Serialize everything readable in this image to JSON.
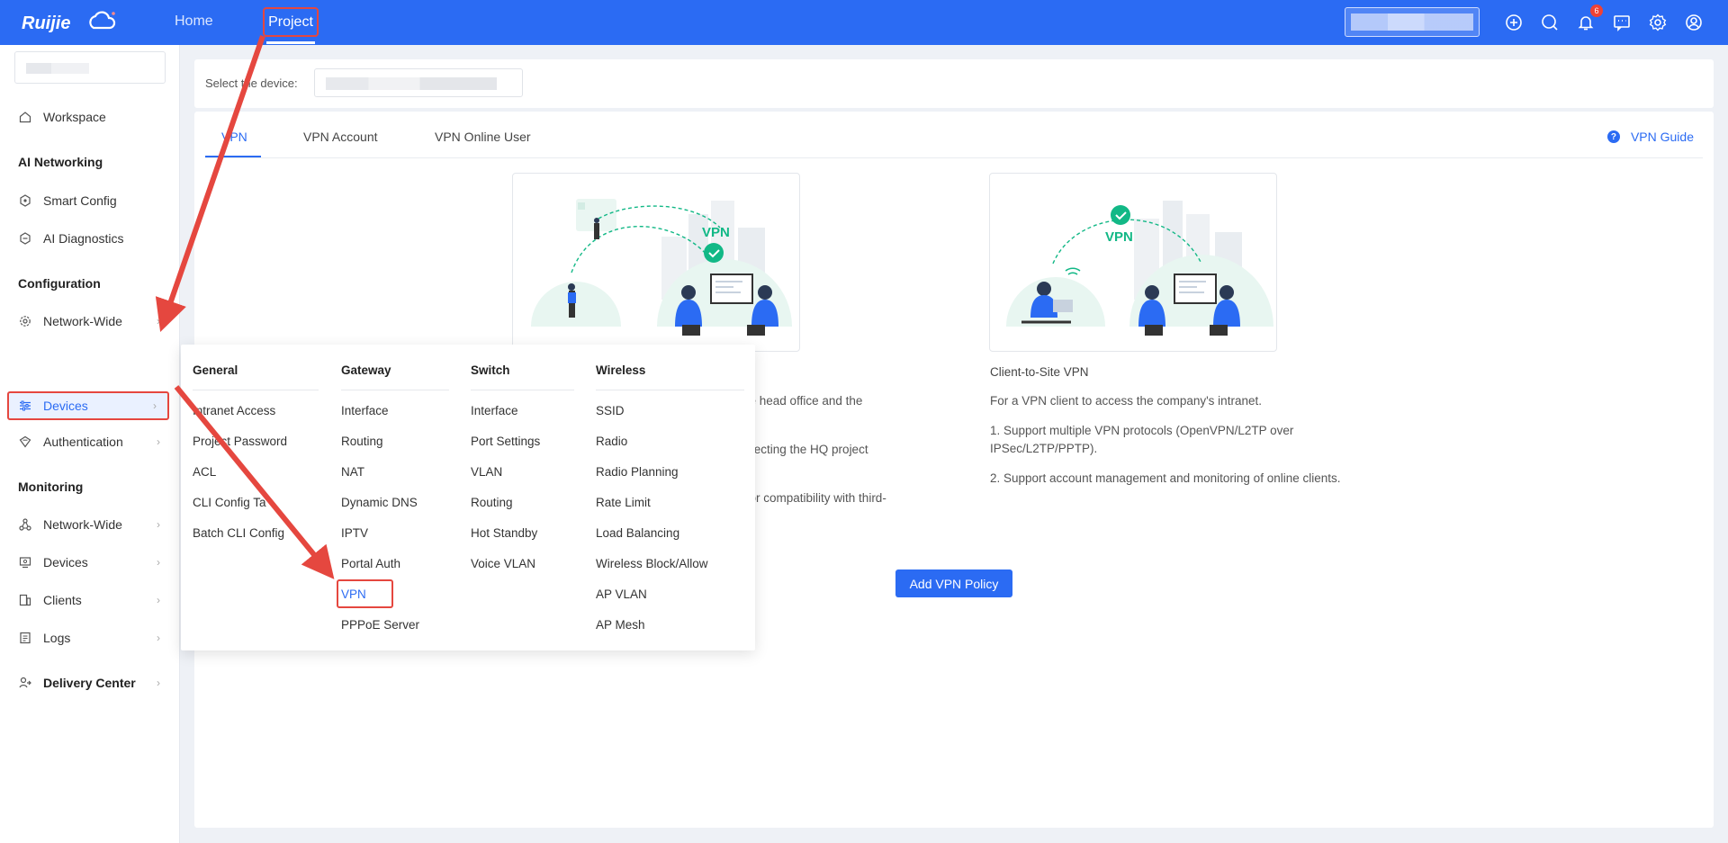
{
  "topbar": {
    "logo_text": "Ruijie",
    "nav": {
      "home": "Home",
      "project": "Project"
    },
    "notification_count": "6",
    "icons": [
      "plus-circle-icon",
      "search-icon",
      "bell-icon",
      "chat-icon",
      "gear-icon",
      "user-icon"
    ]
  },
  "sidebar": {
    "workspace": "Workspace",
    "sections": {
      "ai": "AI Networking",
      "config": "Configuration",
      "monitor": "Monitoring"
    },
    "items": {
      "smart_config": "Smart Config",
      "ai_diag": "AI Diagnostics",
      "cfg_network": "Network-Wide",
      "cfg_devices": "Devices",
      "cfg_auth": "Authentication",
      "mon_network": "Network-Wide",
      "mon_devices": "Devices",
      "mon_clients": "Clients",
      "mon_logs": "Logs",
      "delivery": "Delivery Center"
    }
  },
  "device_bar": {
    "label": "Select the device:"
  },
  "tabs": {
    "vpn": "VPN",
    "account": "VPN Account",
    "online": "VPN Online User",
    "guide": "VPN Guide"
  },
  "site_to_site": {
    "illustration_text": "VPN",
    "lines": [
      "n the head office and the",
      "y selecting the HQ project",
      "on for compatibility with third-"
    ]
  },
  "client_to_site": {
    "illustration_text": "VPN",
    "title": "Client-to-Site VPN",
    "line1": "For a VPN client to access the company's intranet.",
    "line2a": "1. Support multiple VPN protocols (OpenVPN/L2TP over",
    "line2b": "IPSec/L2TP/PPTP).",
    "line3": "2. Support account management and monitoring of online clients."
  },
  "add_button": "Add VPN Policy",
  "menu": {
    "general": {
      "title": "General",
      "items": [
        "Intranet Access",
        "Project Password",
        "ACL",
        "CLI Config Ta",
        "Batch CLI Config"
      ]
    },
    "gateway": {
      "title": "Gateway",
      "items": [
        "Interface",
        "Routing",
        "NAT",
        "Dynamic DNS",
        "IPTV",
        "Portal Auth",
        "VPN",
        "PPPoE Server"
      ]
    },
    "switch": {
      "title": "Switch",
      "items": [
        "Interface",
        "Port Settings",
        "VLAN",
        "Routing",
        "Hot Standby",
        "Voice VLAN"
      ]
    },
    "wireless": {
      "title": "Wireless",
      "items": [
        "SSID",
        "Radio",
        "Radio Planning",
        "Rate Limit",
        "Load Balancing",
        "Wireless Block/Allow",
        "AP VLAN",
        "AP Mesh"
      ]
    }
  },
  "colors": {
    "brand": "#2b6bf3",
    "highlight": "#e5473f",
    "illustration_green": "#12b886"
  }
}
